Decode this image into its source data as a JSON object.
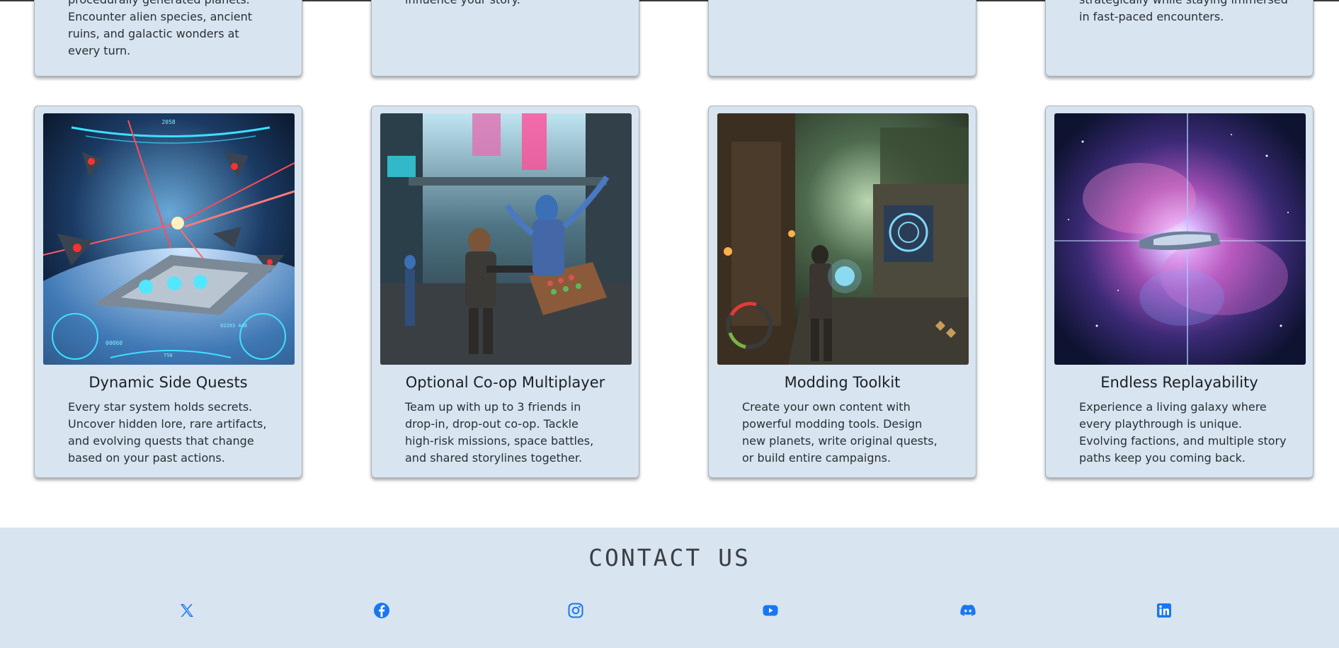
{
  "top_cards": [
    {
      "text": "procedurally generated planets. Encounter alien species, ancient ruins, and galactic wonders at every turn."
    },
    {
      "text": "influence your story."
    },
    {
      "text": ""
    },
    {
      "text": "strategically while staying immersed in fast-paced encounters."
    }
  ],
  "feature_cards": [
    {
      "title": "Dynamic Side Quests",
      "text": "Every star system holds secrets. Uncover hidden lore, rare artifacts, and evolving quests that change based on your past actions.",
      "image": "space-battle-image"
    },
    {
      "title": "Optional Co-op Multiplayer",
      "text": "Team up with up to 3 friends in drop-in, drop-out co-op. Tackle high-risk missions, space battles, and shared storylines together.",
      "image": "alien-market-image"
    },
    {
      "title": "Modding Toolkit",
      "text": "Create your own content with powerful modding tools. Design new planets, write original quests, or build entire campaigns.",
      "image": "jungle-ruins-image"
    },
    {
      "title": "Endless Replayability",
      "text": "Experience a living galaxy where every playthrough is unique. Evolving factions, and multiple story paths keep you coming back.",
      "image": "nebula-ship-image"
    }
  ],
  "hud_text": {
    "year": "2058",
    "score": "00060",
    "readout": "02293 448",
    "speed": "750"
  },
  "contact": {
    "title": "CONTACT US",
    "icons": [
      "x-icon",
      "facebook-icon",
      "instagram-icon",
      "youtube-icon",
      "discord-icon",
      "linkedin-icon"
    ]
  },
  "colors": {
    "card_bg": "#d8e4ef",
    "footer_bg": "#d8e4ef",
    "icon_blue": "#1877f2"
  }
}
